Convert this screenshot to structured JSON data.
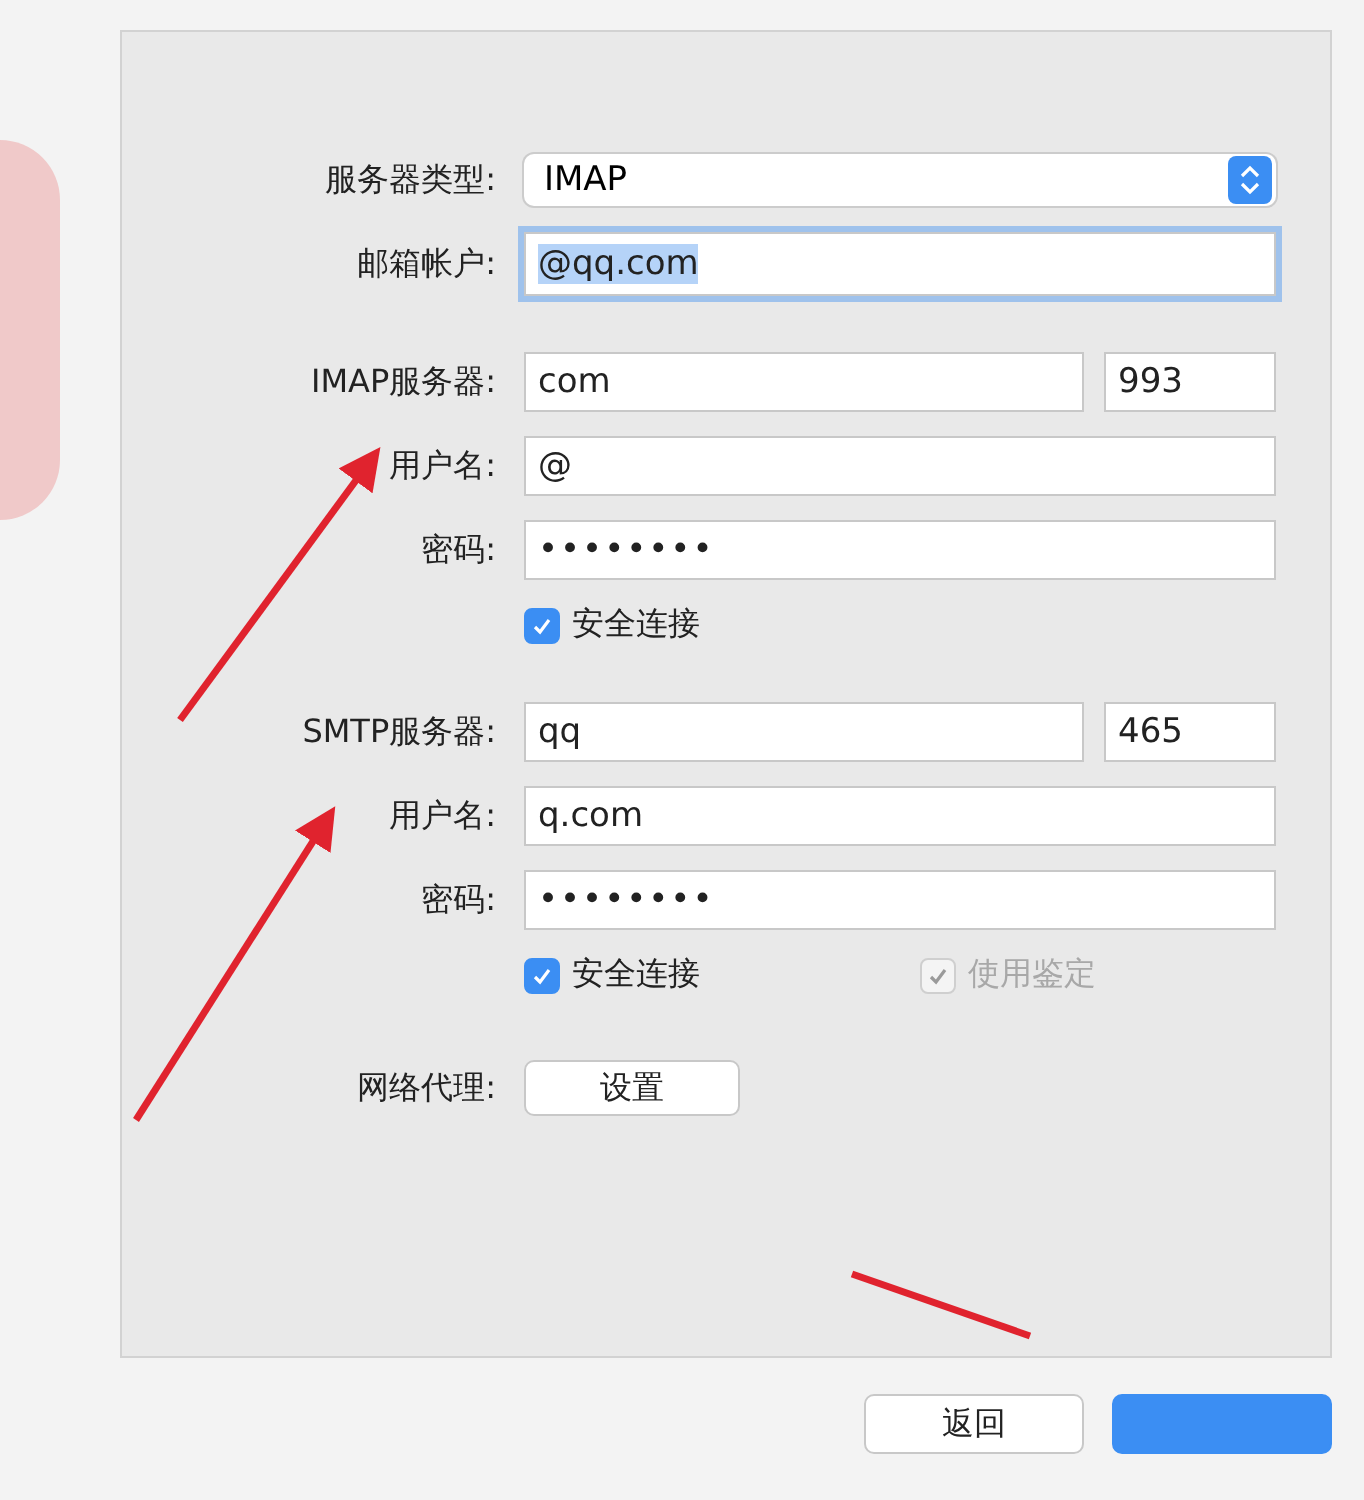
{
  "server_type": {
    "label": "服务器类型:",
    "value": "IMAP"
  },
  "account": {
    "label": "邮箱帐户:",
    "value": "@qq.com",
    "focused": true
  },
  "servers": [
    {
      "label": "IMAP服务器:",
      "server": "com",
      "port": "993",
      "username_label": "用户名:",
      "username": "@",
      "password_label": "密码:",
      "password": "••••••••",
      "options": [
        {
          "label": "安全连接",
          "checked": true,
          "disabled": false
        }
      ]
    },
    {
      "label": "SMTP服务器:",
      "server": "qq",
      "port": "465",
      "username_label": "用户名:",
      "username": "q.com",
      "password_label": "密码:",
      "password": "••••••••",
      "options": [
        {
          "label": "安全连接",
          "checked": true,
          "disabled": false
        },
        {
          "label": "使用鉴定",
          "checked": true,
          "disabled": true
        }
      ]
    }
  ],
  "proxy": {
    "label": "网络代理:",
    "button": "设置"
  },
  "buttons": [
    {
      "label": "返回",
      "kind": "default"
    },
    {
      "kind": "primary"
    }
  ]
}
